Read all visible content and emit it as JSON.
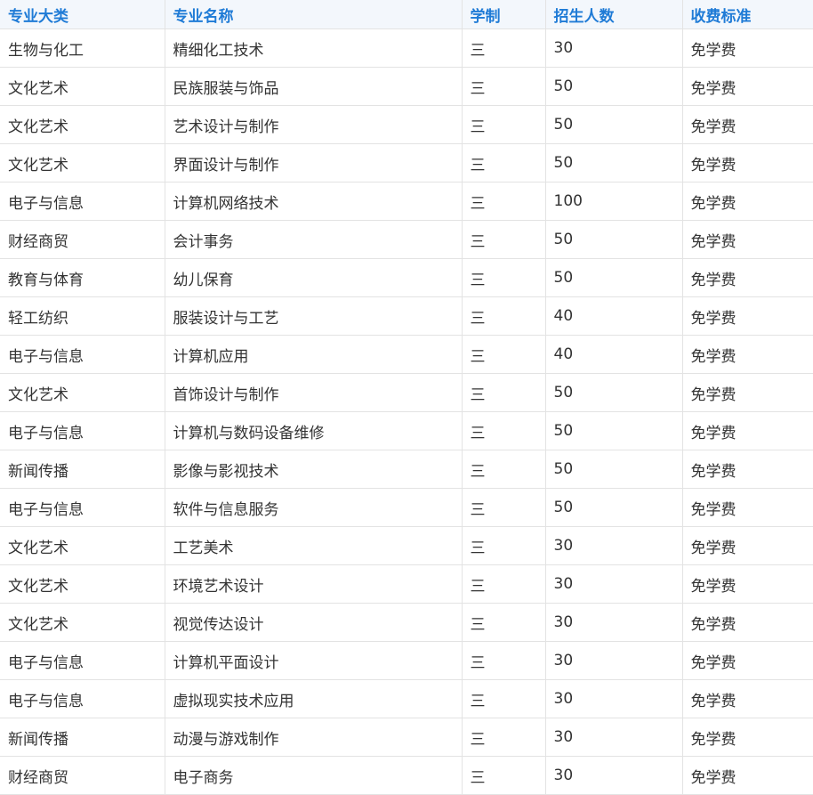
{
  "table": {
    "headers": [
      "专业大类",
      "专业名称",
      "学制",
      "招生人数",
      "收费标准"
    ],
    "rows": [
      [
        "生物与化工",
        "精细化工技术",
        "三",
        "30",
        "免学费"
      ],
      [
        "文化艺术",
        "民族服装与饰品",
        "三",
        "50",
        "免学费"
      ],
      [
        "文化艺术",
        "艺术设计与制作",
        "三",
        "50",
        "免学费"
      ],
      [
        "文化艺术",
        "界面设计与制作",
        "三",
        "50",
        "免学费"
      ],
      [
        "电子与信息",
        "计算机网络技术",
        "三",
        "100",
        "免学费"
      ],
      [
        "财经商贸",
        "会计事务",
        "三",
        "50",
        "免学费"
      ],
      [
        "教育与体育",
        "幼儿保育",
        "三",
        "50",
        "免学费"
      ],
      [
        "轻工纺织",
        "服装设计与工艺",
        "三",
        "40",
        "免学费"
      ],
      [
        "电子与信息",
        "计算机应用",
        "三",
        "40",
        "免学费"
      ],
      [
        "文化艺术",
        "首饰设计与制作",
        "三",
        "50",
        "免学费"
      ],
      [
        "电子与信息",
        "计算机与数码设备维修",
        "三",
        "50",
        "免学费"
      ],
      [
        "新闻传播",
        "影像与影视技术",
        "三",
        "50",
        "免学费"
      ],
      [
        "电子与信息",
        "软件与信息服务",
        "三",
        "50",
        "免学费"
      ],
      [
        "文化艺术",
        "工艺美术",
        "三",
        "30",
        "免学费"
      ],
      [
        "文化艺术",
        "环境艺术设计",
        "三",
        "30",
        "免学费"
      ],
      [
        "文化艺术",
        "视觉传达设计",
        "三",
        "30",
        "免学费"
      ],
      [
        "电子与信息",
        "计算机平面设计",
        "三",
        "30",
        "免学费"
      ],
      [
        "电子与信息",
        "虚拟现实技术应用",
        "三",
        "30",
        "免学费"
      ],
      [
        "新闻传播",
        "动漫与游戏制作",
        "三",
        "30",
        "免学费"
      ],
      [
        "财经商贸",
        "电子商务",
        "三",
        "30",
        "免学费"
      ]
    ]
  }
}
